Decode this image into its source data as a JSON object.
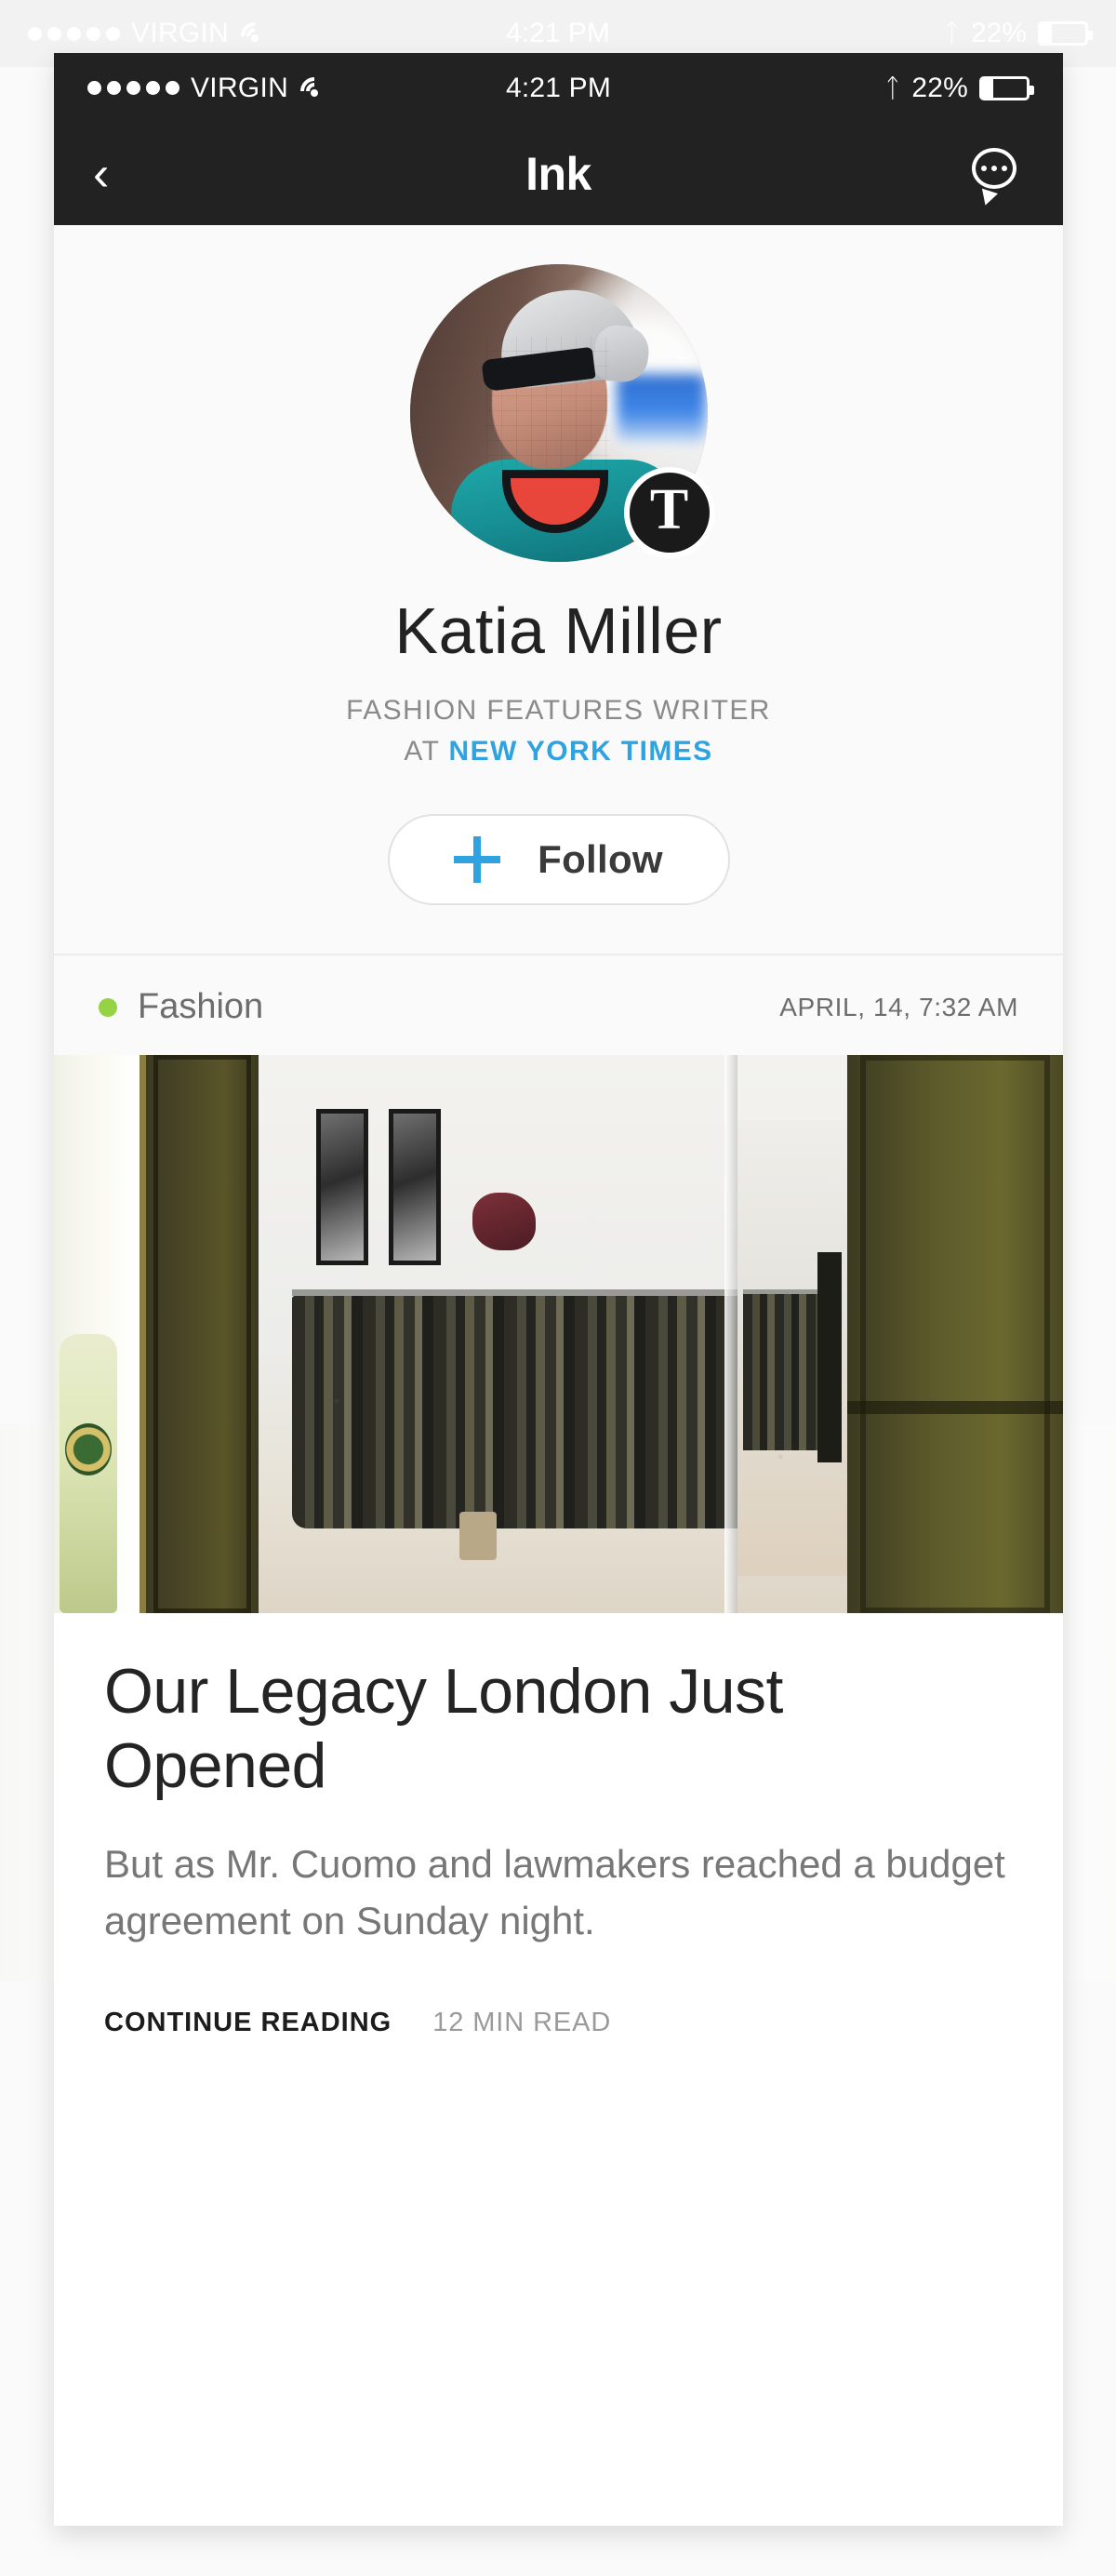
{
  "status_bar": {
    "signal_dots": 5,
    "carrier": "VIRGIN",
    "wifi_icon": "wifi-icon",
    "time": "4:21 PM",
    "bluetooth_icon": "bluetooth-icon",
    "battery_percent": "22%",
    "battery_level": 22
  },
  "nav": {
    "back_icon": "chevron-left-icon",
    "title": "Ink",
    "chat_icon": "chat-bubble-icon"
  },
  "profile": {
    "avatar_alt": "katia-miller-avatar",
    "badge_letter": "T",
    "badge_name": "new-york-times-badge",
    "name": "Katia Miller",
    "role": "FASHION FEATURES WRITER",
    "at_word": "AT",
    "organization": "NEW YORK TIMES",
    "follow_label": "Follow",
    "follow_icon": "plus-icon"
  },
  "feed": {
    "category": "Fashion",
    "category_color": "#95d244",
    "date": "APRIL, 14,  7:32 AM",
    "article": {
      "photo_alt": "our-legacy-store-interior-photo",
      "title": "Our Legacy London Just Opened",
      "excerpt": "But as Mr. Cuomo and lawmakers reached a budget agreement on Sunday night.",
      "continue_label": "CONTINUE READING",
      "read_time": "12 MIN READ"
    }
  },
  "colors": {
    "nav_background": "#222222",
    "accent_blue": "#2ea3e0",
    "category_green": "#95d244",
    "page_background": "#ffffff",
    "card_background": "#fafafa"
  }
}
